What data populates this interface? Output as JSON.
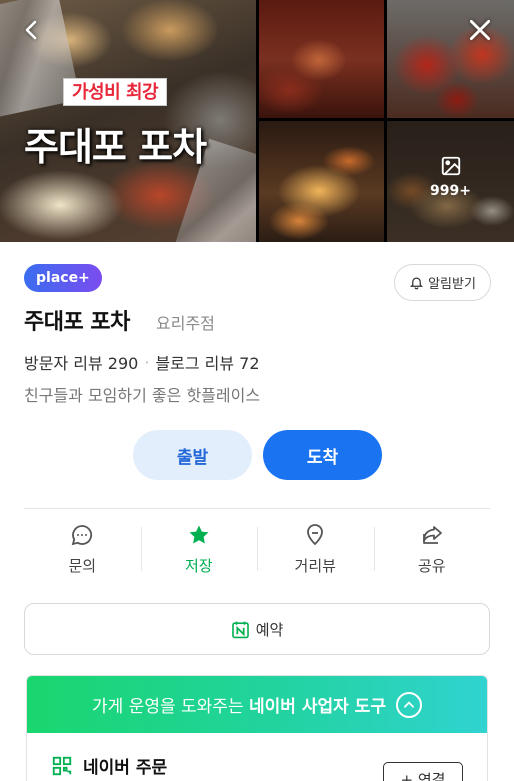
{
  "gallery": {
    "promo_tag": "가성비 최강",
    "promo_title": "주대포 포차",
    "photo_count": "999+"
  },
  "badge": {
    "label": "place+"
  },
  "alert_button": {
    "label": "알림받기"
  },
  "place": {
    "name": "주대포 포차",
    "category": "요리주점",
    "visitor_reviews": "방문자 리뷰 290",
    "blog_reviews": "블로그 리뷰 72",
    "description": "친구들과 모임하기 좋은 핫플레이스"
  },
  "route": {
    "depart_label": "출발",
    "arrive_label": "도착"
  },
  "actions": [
    {
      "label": "문의",
      "icon": "chat-bubble-icon"
    },
    {
      "label": "저장",
      "icon": "star-icon",
      "active": true
    },
    {
      "label": "거리뷰",
      "icon": "map-pin-icon"
    },
    {
      "label": "공유",
      "icon": "share-icon"
    }
  ],
  "reserve": {
    "label": "예약"
  },
  "biz_banner": {
    "text_prefix": "가게 운영을 도와주는",
    "text_bold": "네이버 사업자 도구"
  },
  "order": {
    "label": "네이버 주문",
    "connect_label": "+ 연결"
  },
  "colors": {
    "primary": "#1a73f0",
    "green": "#00b050",
    "banner_start": "#19d66e",
    "banner_end": "#30d3d0"
  }
}
